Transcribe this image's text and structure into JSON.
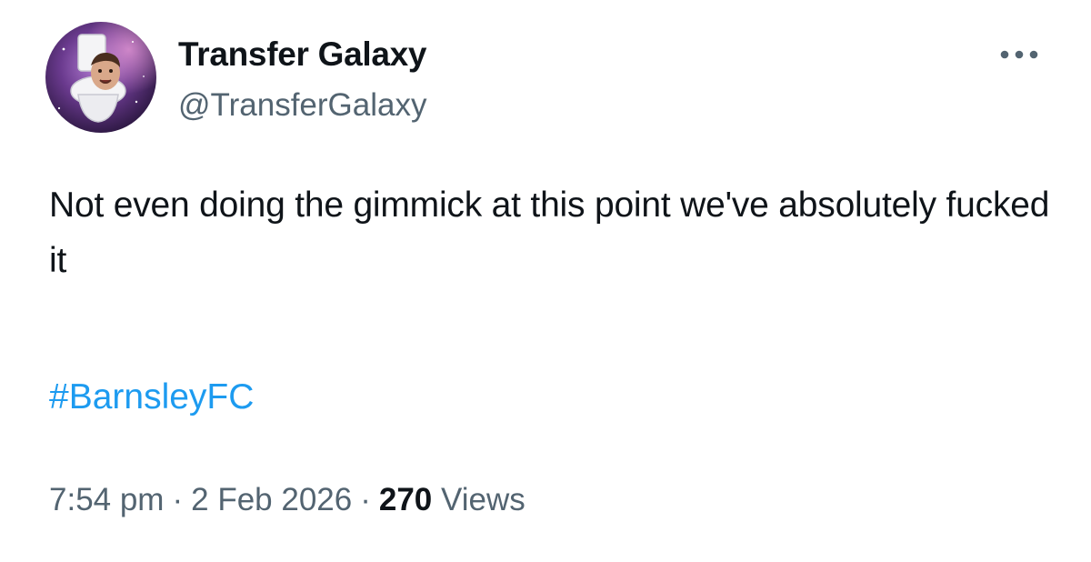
{
  "author": {
    "display_name": "Transfer Galaxy",
    "handle": "@TransferGalaxy",
    "avatar_icon": "toilet-head-avatar-icon"
  },
  "menu": {
    "more_icon": "more-horizontal-icon"
  },
  "tweet": {
    "text": "Not even doing the gimmick at this point we've absolutely fucked it",
    "hashtag": "#BarnsleyFC"
  },
  "meta": {
    "time": "7:54 pm",
    "date": "2 Feb 2026",
    "separator": "·",
    "views_count": "270",
    "views_label": "Views"
  },
  "colors": {
    "text_primary": "#0f1419",
    "text_secondary": "#536471",
    "link": "#1d9bf0",
    "background": "#ffffff"
  }
}
